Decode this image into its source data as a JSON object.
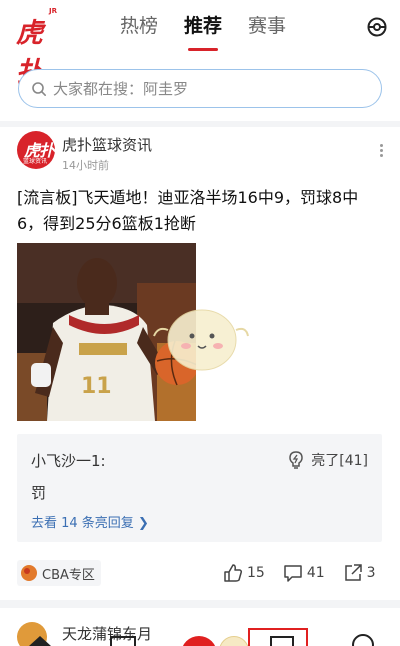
{
  "header": {
    "logo_text": "虎扑",
    "logo_sup": "JR",
    "tabs": [
      {
        "label": "热榜",
        "active": false
      },
      {
        "label": "推荐",
        "active": true
      },
      {
        "label": "赛事",
        "active": false
      }
    ],
    "right_icon": "pokeball-icon"
  },
  "search": {
    "icon": "search-icon",
    "text": "大家都在搜：阿圭罗"
  },
  "post": {
    "avatar_text": "虎扑",
    "avatar_subtext": "篮球资讯",
    "author": "虎扑篮球资讯",
    "time": "14小时前",
    "headline": "[流言板]飞天遁地！迪亚洛半场16中9，罚球8中6，得到25分6篮板1抢断",
    "hot_comment": {
      "user": "小飞沙一1:",
      "likes": "亮了[41]",
      "body": "罚",
      "more_link": "去看 14 条亮回复 ❯"
    },
    "tag": "CBA专区",
    "actions": {
      "likes": "15",
      "comments": "41",
      "shares": "3"
    }
  },
  "next_post": {
    "author": "天龙蒲锦东月"
  },
  "colors": {
    "brand_red": "#d8232a",
    "link_blue": "#3b6fb3",
    "search_border": "#9cc3ea"
  }
}
